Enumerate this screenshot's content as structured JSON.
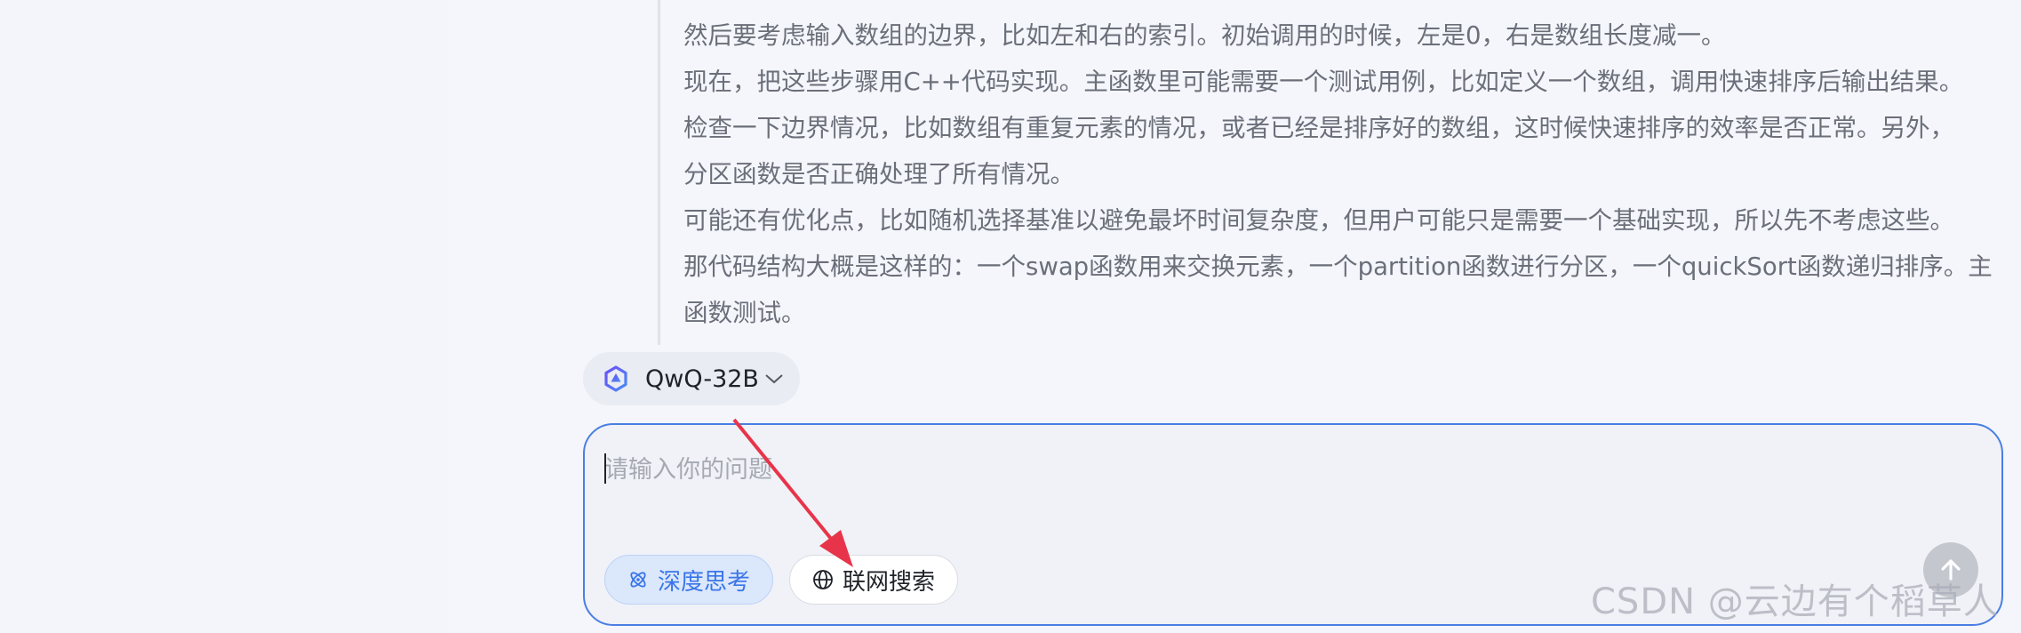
{
  "thinking": {
    "lines": [
      "然后要考虑输入数组的边界，比如左和右的索引。初始调用的时候，左是0，右是数组长度减一。",
      "现在，把这些步骤用C++代码实现。主函数里可能需要一个测试用例，比如定义一个数组，调用快速排序后输出结果。",
      "检查一下边界情况，比如数组有重复元素的情况，或者已经是排序好的数组，这时候快速排序的效率是否正常。另外，",
      "分区函数是否正确处理了所有情况。",
      "可能还有优化点，比如随机选择基准以避免最坏时间复杂度，但用户可能只是需要一个基础实现，所以先不考虑这些。",
      "那代码结构大概是这样的：一个swap函数用来交换元素，一个partition函数进行分区，一个quickSort函数递归排序。主",
      "函数测试。"
    ]
  },
  "model_selector": {
    "name": "QwQ-32B",
    "icon": "qwen-logo-icon"
  },
  "composer": {
    "value": "",
    "placeholder": "请输入你的问题",
    "deep_think_label": "深度思考",
    "web_search_label": "联网搜索",
    "send_icon": "arrow-up-icon"
  },
  "annotation": {
    "color": "#e8344a"
  },
  "watermark": {
    "text": "CSDN @云边有个稻草人"
  },
  "colors": {
    "accent": "#4a7ee3",
    "deep_think_bg": "#dbe7fb",
    "page_bg": "#f4f6fb"
  }
}
